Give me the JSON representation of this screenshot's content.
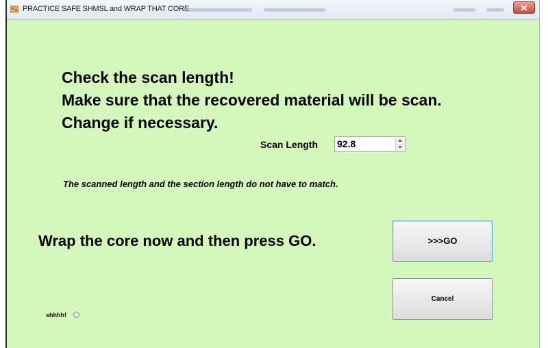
{
  "window": {
    "title": "PRACTICE SAFE SHMSL and WRAP THAT CORE",
    "background": "#d4f8bc"
  },
  "instructions": {
    "line1": "Check the scan length!",
    "line2": "Make sure that the recovered material will be scan.",
    "line3": "Change if necessary."
  },
  "scan": {
    "label": "Scan Length",
    "value": "92.8"
  },
  "note": "The scanned length and the section length do not have to match.",
  "wrap_instruction": "Wrap the core now and then press GO.",
  "buttons": {
    "go": ">>>GO",
    "cancel": "Cancel"
  },
  "option": {
    "label": "shhhh!",
    "selected": false
  },
  "icons": [
    "app-icon",
    "close-icon",
    "spin-up-icon",
    "spin-down-icon"
  ]
}
